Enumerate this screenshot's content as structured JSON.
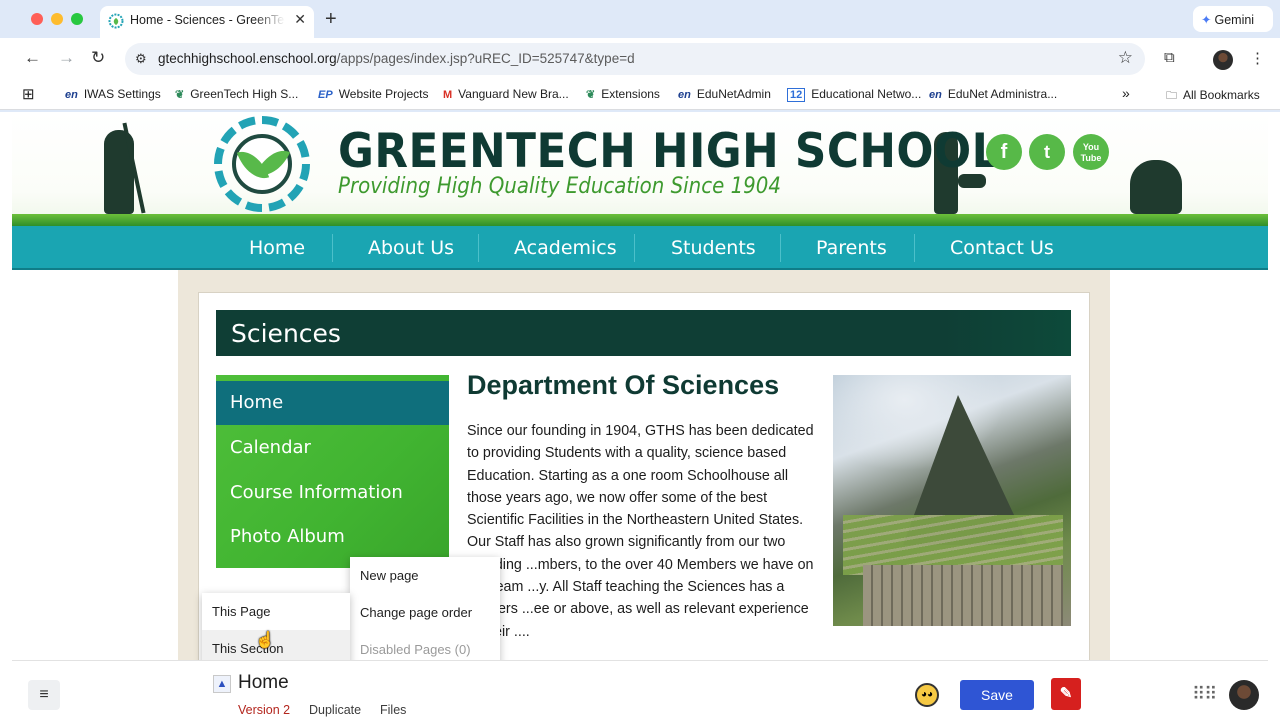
{
  "browser": {
    "tab_title": "Home - Sciences - GreenTech",
    "tab_close": "✕",
    "new_tab": "+",
    "gemini_label": "Gemini",
    "url_host": "gtechhighschool.enschool.org",
    "url_path": "/apps/pages/index.jsp?uREC_ID=525747&type=d",
    "bookmarks": [
      {
        "icon": "en",
        "label": "IWAS Settings"
      },
      {
        "icon": "gt",
        "label": "GreenTech High S..."
      },
      {
        "icon": "ep",
        "label": "Website Projects"
      },
      {
        "icon": "M",
        "label": "Vanguard New Bra..."
      },
      {
        "icon": "gt",
        "label": "Extensions"
      },
      {
        "icon": "en",
        "label": "EduNetAdmin"
      },
      {
        "icon": "12",
        "label": "Educational Netwo..."
      },
      {
        "icon": "en",
        "label": "EduNet Administra..."
      }
    ],
    "bookmarks_overflow": "»",
    "all_bookmarks": "All Bookmarks"
  },
  "site": {
    "school_name": "GREENTECH HIGH SCHOOL",
    "tagline": "Providing High Quality Education Since 1904",
    "social": [
      {
        "icon": "facebook-icon",
        "glyph": "f"
      },
      {
        "icon": "twitter-icon",
        "glyph": "t"
      },
      {
        "icon": "youtube-icon",
        "glyph": "You Tube"
      }
    ],
    "nav": [
      "Home",
      "About Us",
      "Academics",
      "Students",
      "Parents",
      "Contact Us"
    ],
    "section_title": "Sciences",
    "side_menu": [
      "Home",
      "Calendar",
      "Course Information",
      "Photo Album"
    ],
    "side_menu_active": "Home",
    "dept_title": "Department Of Sciences",
    "dept_body": "Since our founding in 1904, GTHS has been dedicated to providing Students with a quality, science based Education. Starting as a one room Schoolhouse all those years ago, we now offer some of the best Scientific Facilities in the Northeastern United States. Our Staff has also grown significantly from our two founding ...mbers, to the over 40 Members we have on our team ...y. All Staff teaching the Sciences has a Masters ...ee or above, as well as relevant experience in their ...."
  },
  "popup": {
    "left_items": [
      "This Page",
      "This Section"
    ],
    "right_items": [
      "New page",
      "Change page order",
      "Disabled Pages (0)"
    ]
  },
  "editor": {
    "menu_glyph": "≡",
    "toggle_glyph": "▲",
    "page_name": "Home",
    "links": [
      "Version 2",
      "Duplicate",
      "Files"
    ],
    "save_label": "Save"
  },
  "colors": {
    "nav_teal": "#1aa5b2",
    "brand_dark_green": "#0f3a33",
    "brand_green": "#3e9a2f",
    "save_blue": "#2f55d4",
    "version_red": "#b3261e"
  }
}
